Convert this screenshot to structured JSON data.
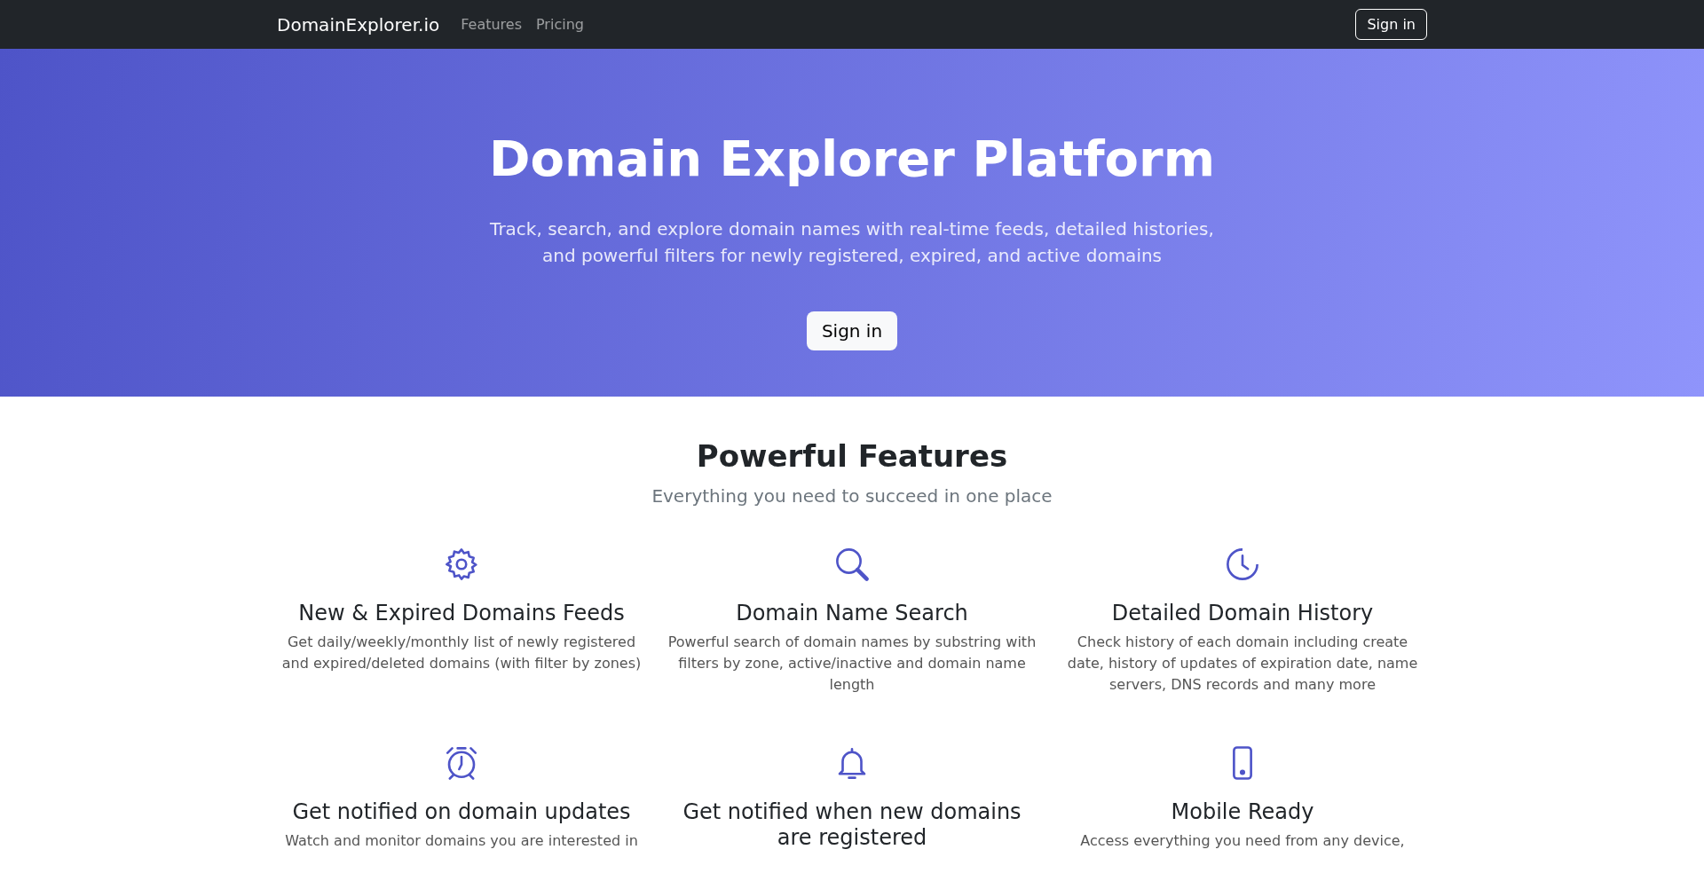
{
  "navbar": {
    "brand": "DomainExplorer.io",
    "links": [
      {
        "label": "Features"
      },
      {
        "label": "Pricing"
      }
    ],
    "sign_in": "Sign in"
  },
  "hero": {
    "title": "Domain Explorer Platform",
    "subtitle": "Track, search, and explore domain names with real-time feeds, detailed histories, and powerful filters for newly registered, expired, and active domains",
    "button": "Sign in"
  },
  "features": {
    "title": "Powerful Features",
    "subtitle": "Everything you need to succeed in one place",
    "items": [
      {
        "kind": "gear",
        "title": "New & Expired Domains Feeds",
        "description": "Get daily/weekly/monthly list of newly registered and expired/deleted domains (with filter by zones)"
      },
      {
        "kind": "search",
        "title": "Domain Name Search",
        "description": "Powerful search of domain names by substring with filters by zone, active/inactive and domain name length"
      },
      {
        "kind": "history",
        "title": "Detailed Domain History",
        "description": "Check history of each domain including create date, history of updates of expiration date, name servers, DNS records and many more"
      },
      {
        "kind": "alarm",
        "title": "Get notified on domain updates",
        "description": "Watch and monitor domains you are interested in"
      },
      {
        "kind": "bell",
        "title": "Get notified when new domains are registered"
      },
      {
        "kind": "phone",
        "title": "Mobile Ready",
        "description": "Access everything you need from any device,"
      }
    ]
  }
}
